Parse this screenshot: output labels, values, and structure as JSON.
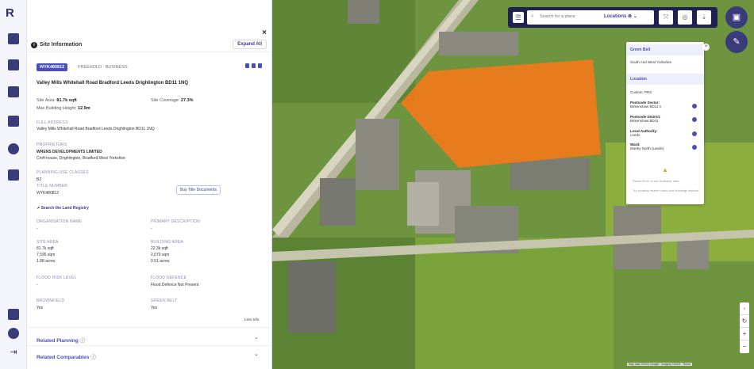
{
  "app": {
    "logo": "R"
  },
  "rail": {
    "icons": [
      "map-pin-icon",
      "copy-icon",
      "layout-icon",
      "folder-icon",
      "bell-icon",
      "calendar-icon",
      "play-icon",
      "feedback-icon",
      "logout-icon"
    ]
  },
  "panel": {
    "title": "Site Information",
    "expand_label": "Expand All",
    "close": "×",
    "tag": "WYK480812",
    "tenure": "FREEHOLD · BUSINESS",
    "address": "Valley Mills Whitehall Road Bradford Leeds Drighlington BD11 1NQ",
    "site_area_label": "Site Area:",
    "site_area": "81.7k sqft",
    "site_coverage_label": "Site Coverage:",
    "site_coverage": "27.3%",
    "max_height_label": "Max Building Height:",
    "max_height": "12.9m",
    "full_address_label": "FULL ADDRESS",
    "full_address": "Valley Mills Whitehall Road Bradford Leeds Drighlington BD11 1NQ",
    "proprietors_label": "PROPRIETORS",
    "proprietor_name": "WRENS DEVELOPMENTS LIMITED",
    "proprietor_addr": "Croft house, Drighlington, Bradford,West Yorkshire",
    "planning_label": "PLANNING USE CLASSES",
    "planning_value": "B2",
    "title_number_label": "TITLE NUMBER",
    "title_number": "WYK480812",
    "buy_title": "Buy Title Documents",
    "land_registry": "Search the Land Registry",
    "org_name_label": "ORGANISATION NAME",
    "org_name": "-",
    "primary_desc_label": "PRIMARY DESCRIPTION",
    "primary_desc": "-",
    "site_area2_label": "SITE AREA",
    "site_area2": [
      "81.7k sqft",
      "7,595 sqm",
      "1.88 acres"
    ],
    "building_area_label": "BUILDING AREA",
    "building_area": [
      "22.3k sqft",
      "2,070 sqm",
      "0.51 acres"
    ],
    "flood_label": "FLOOD RISK LEVEL",
    "flood_value": "-",
    "flood_def_label": "FLOOD DEFENCE",
    "flood_def_value": "Flood Defence Not Present",
    "brownfield_label": "BROWNFIELD",
    "brownfield_value": "Yes",
    "greenbelt_label": "GREEN BELT",
    "greenbelt_value": "Yes",
    "see_info": "Less Info",
    "related_planning": "Related Planning",
    "related_comparables": "Related Comparables"
  },
  "toolbar": {
    "search_placeholder": "Search for a place",
    "locations_label": "Locations"
  },
  "popup": {
    "green_belt_label": "Green Belt",
    "green_belt_value": "South And West Yorkshire",
    "location_label": "Location",
    "custom": "Custom: PR3",
    "postcode_sector_label": "Postcode Sector:",
    "postcode_sector": "Birkenshaw BD11 1",
    "postcode_district_label": "Postcode District:",
    "postcode_district": "Birkenshaw BD11",
    "local_auth_label": "Local Authority:",
    "local_auth": "Leeds",
    "ward_label": "Ward:",
    "ward": "Morley North (Leeds)",
    "warn1": "Reach Error in our available data",
    "warn2": "Try locating nearer roads and buildings instead"
  },
  "map": {
    "attribution": "Map data ©2024 Google · Imagery ©2024 · Terms"
  },
  "colors": {
    "accent": "#4b4fb8",
    "site_polygon": "#f07a1a",
    "navy": "#1f2250"
  }
}
